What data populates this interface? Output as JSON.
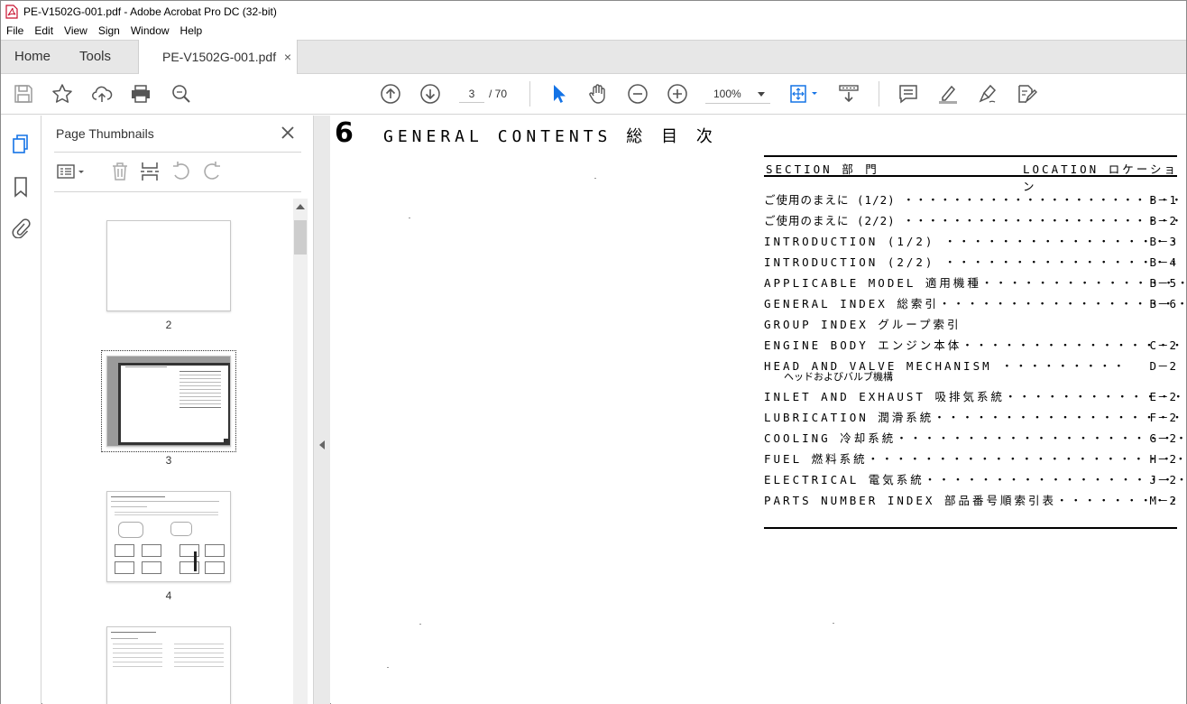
{
  "window": {
    "title": "PE-V1502G-001.pdf - Adobe Acrobat Pro DC (32-bit)"
  },
  "menu": [
    "File",
    "Edit",
    "View",
    "Sign",
    "Window",
    "Help"
  ],
  "tabs": {
    "home": "Home",
    "tools": "Tools",
    "document": "PE-V1502G-001.pdf",
    "close": "×"
  },
  "toolbar": {
    "current_page": "3",
    "page_total": "/ 70",
    "zoom": "100%",
    "icons": [
      "save-icon",
      "star-icon",
      "upload-icon",
      "print-icon",
      "zoom-search-icon",
      "page-up-icon",
      "page-down-icon",
      "select-arrow-icon",
      "hand-icon",
      "zoom-out-icon",
      "zoom-in-icon",
      "fit-page-icon",
      "scroll-mode-icon",
      "comment-icon",
      "highlight-icon",
      "sign-icon",
      "fill-sign-icon"
    ]
  },
  "sidebar": {
    "title": "Page Thumbnails",
    "thumbnails": [
      {
        "label": "2"
      },
      {
        "label": "3"
      },
      {
        "label": "4"
      },
      {
        "label": ""
      }
    ]
  },
  "document": {
    "section_number": "6",
    "heading": "GENERAL CONTENTS 総 目 次",
    "col_section": "SECTION 部 門",
    "col_location": "LOCATION ロケーション",
    "entries": [
      {
        "text": "ご使用のまえに (1/2) ・・・・・・・・・・・・・・・・・・・・・・・・・",
        "loc": "B－1"
      },
      {
        "text": "ご使用のまえに (2/2) ・・・・・・・・・・・・・・・・・・・・・・・・・",
        "loc": "B－2"
      },
      {
        "text": " INTRODUCTION (1/2) ・・・・・・・・・・・・・・・・・・・・・",
        "loc": "B－3"
      },
      {
        "text": " INTRODUCTION (2/2) ・・・・・・・・・・・・・・・・・・・・・",
        "loc": "B－4"
      },
      {
        "text": "APPLICABLE MODEL 適用機種・・・・・・・・・・・・・・・・・",
        "loc": "B－5"
      },
      {
        "text": "GENERAL  INDEX 総索引・・・・・・・・・・・・・・・・・・・・",
        "loc": "B－6"
      },
      {
        "text": "GROUP  INDEX グループ索引",
        "loc": ""
      },
      {
        "text": "  ENGINE BODY エンジン本体・・・・・・・・・・・・・・・・・・",
        "loc": "C－2"
      },
      {
        "text": "  HEAD AND VALVE MECHANISM ・・・・・・・・・",
        "loc": "D－2",
        "sub": "ヘッドおよびバルブ機構"
      },
      {
        "text": "  INLET AND EXHAUST 吸排気系統・・・・・・・・・・・・・・",
        "loc": "E－2"
      },
      {
        "text": "  LUBRICATION 潤滑系統・・・・・・・・・・・・・・・・・・・・・",
        "loc": "F－2"
      },
      {
        "text": "  COOLING 冷却系統・・・・・・・・・・・・・・・・・・・・・・・・・・",
        "loc": "G－2"
      },
      {
        "text": "  FUEL 燃料系統・・・・・・・・・・・・・・・・・・・・・・・・・・・・・",
        "loc": "H－2"
      },
      {
        "text": "  ELECTRICAL 電気系統・・・・・・・・・・・・・・・・・・・・・・・",
        "loc": "J－2"
      },
      {
        "text": "PARTS NUMBER INDEX 部品番号順索引表・・・・・・・・・",
        "loc": "M－2"
      }
    ]
  }
}
